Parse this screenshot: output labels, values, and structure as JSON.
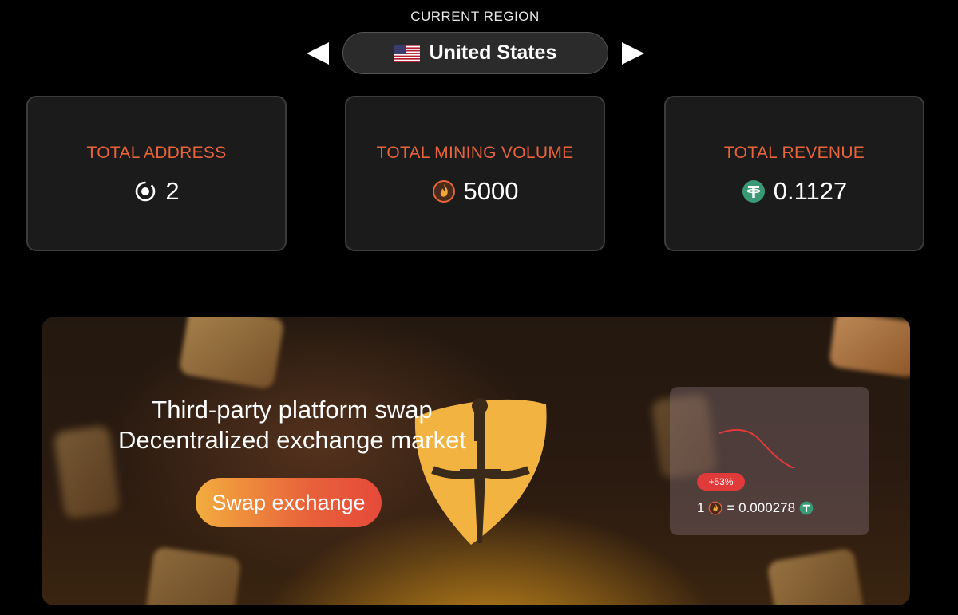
{
  "region": {
    "label": "CURRENT REGION",
    "name": "United States",
    "flag_icon": "us-flag-icon",
    "prev_icon": "triangle-left-icon",
    "next_icon": "triangle-right-icon"
  },
  "stats": [
    {
      "title": "TOTAL ADDRESS",
      "value": "2",
      "icon": "address-icon"
    },
    {
      "title": "TOTAL MINING VOLUME",
      "value": "5000",
      "icon": "mining-coin-icon"
    },
    {
      "title": "TOTAL REVENUE",
      "value": "0.1127",
      "icon": "tether-icon"
    }
  ],
  "banner": {
    "line1": "Third-party platform swap",
    "line2": "Decentralized exchange market",
    "button_label": "Swap exchange",
    "rate_card": {
      "change_badge": "+53%",
      "rate_left": "1",
      "rate_right": "= 0.000278",
      "trend": "down"
    }
  },
  "colors": {
    "accent": "#e8643b",
    "tether": "#3a9a75",
    "badge": "#e03a3a",
    "button_start": "#f3ad3f",
    "button_end": "#e64a3a"
  }
}
